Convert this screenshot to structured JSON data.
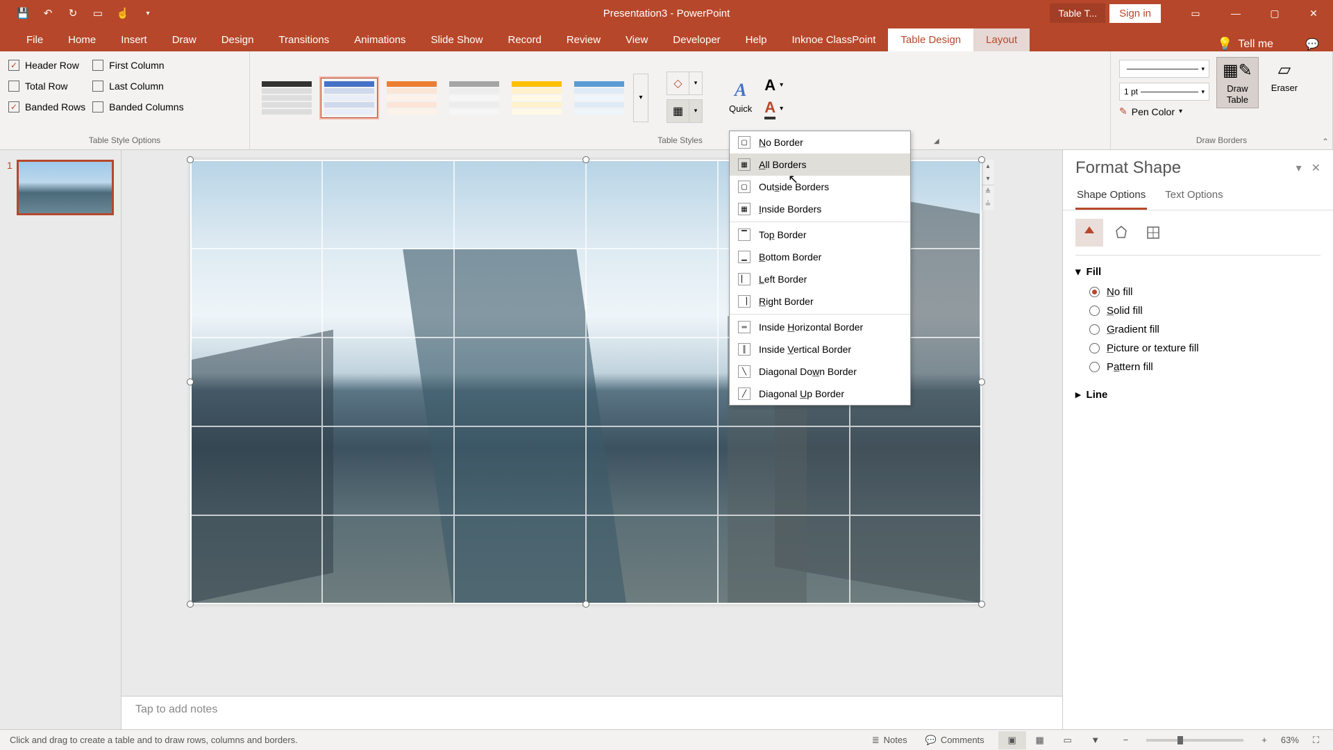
{
  "titlebar": {
    "doc_title": "Presentation3  -  PowerPoint",
    "prebutton": "Table T...",
    "signin": "Sign in"
  },
  "tabs": {
    "file": "File",
    "home": "Home",
    "insert": "Insert",
    "draw": "Draw",
    "design": "Design",
    "transitions": "Transitions",
    "animations": "Animations",
    "slideshow": "Slide Show",
    "record": "Record",
    "review": "Review",
    "view": "View",
    "developer": "Developer",
    "help": "Help",
    "inknoe": "Inknoe ClassPoint",
    "tabledesign": "Table Design",
    "layout": "Layout",
    "tellme": "Tell me"
  },
  "ribbon": {
    "opts": {
      "header_row": "Header Row",
      "first_col": "First Column",
      "total_row": "Total Row",
      "last_col": "Last Column",
      "banded_rows": "Banded Rows",
      "banded_cols": "Banded Columns",
      "group": "Table Style Options"
    },
    "styles_group": "Table Styles",
    "quick": "Quick",
    "draw_borders": "Draw Borders",
    "pen_width": "1 pt",
    "pen_color": "Pen Color",
    "draw_table": "Draw\nTable",
    "eraser": "Eraser"
  },
  "dropdown": {
    "no_border": "No Border",
    "all_borders": "All Borders",
    "outside": "Outside Borders",
    "inside": "Inside Borders",
    "top": "Top Border",
    "bottom": "Bottom Border",
    "left": "Left Border",
    "right": "Right Border",
    "inside_h": "Inside Horizontal Border",
    "inside_v": "Inside Vertical Border",
    "diag_down": "Diagonal Down Border",
    "diag_up": "Diagonal Up Border"
  },
  "thumbs": {
    "num1": "1"
  },
  "notes_placeholder": "Tap to add notes",
  "pane": {
    "title": "Format Shape",
    "tab_shape": "Shape Options",
    "tab_text": "Text Options",
    "fill": "Fill",
    "nofill": "No fill",
    "solid": "Solid fill",
    "gradient": "Gradient fill",
    "picture": "Picture or texture fill",
    "pattern": "Pattern fill",
    "line": "Line"
  },
  "status": {
    "left": "Click and drag to create a table and to draw rows, columns and borders.",
    "notes": "Notes",
    "comments": "Comments",
    "zoom": "63%"
  }
}
